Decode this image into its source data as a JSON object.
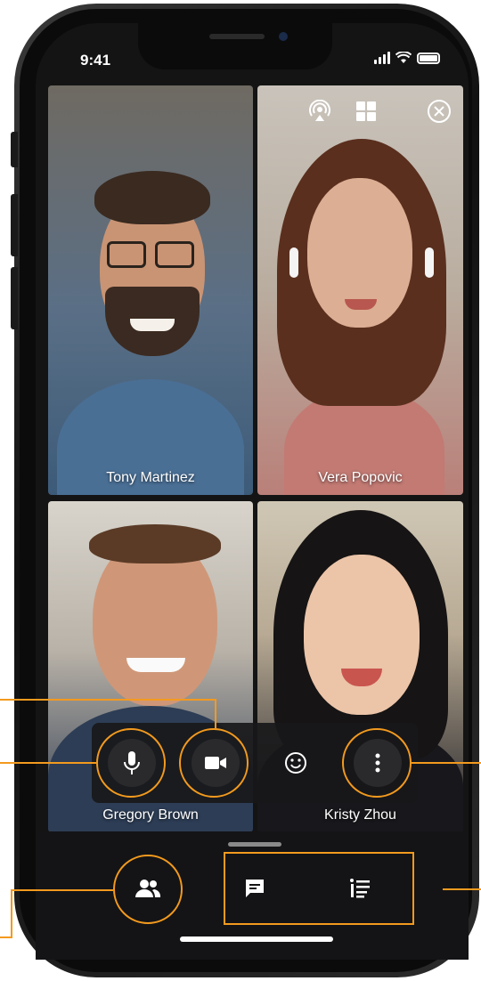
{
  "status_bar": {
    "time": "9:41"
  },
  "participants": [
    {
      "name": "Tony Martinez"
    },
    {
      "name": "Vera Popovic"
    },
    {
      "name": "Gregory Brown"
    },
    {
      "name": "Kristy Zhou"
    }
  ],
  "top_controls": [
    "cast-icon",
    "grid-view-icon",
    "close-icon"
  ],
  "call_controls": [
    "microphone-icon",
    "camera-icon",
    "emoji-icon",
    "more-icon"
  ],
  "bottom_controls": [
    "participants-icon",
    "chat-icon",
    "agenda-icon"
  ],
  "colors": {
    "accent": "#f39a1e",
    "panel": "#1a1a1c",
    "text": "#ffffff"
  }
}
